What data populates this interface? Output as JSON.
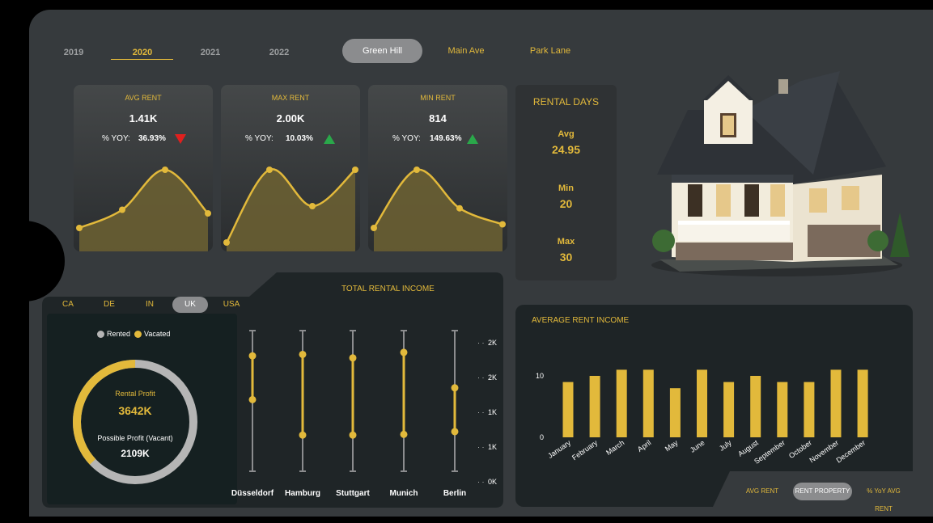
{
  "years": [
    "2019",
    "2020",
    "2021",
    "2022"
  ],
  "selected_year": "2020",
  "properties": [
    "Green Hill",
    "Main Ave",
    "Park Lane"
  ],
  "selected_property": "Green Hill",
  "kpis": [
    {
      "label": "AVG RENT",
      "value": "1.41K",
      "yoy_label": "% YOY:",
      "yoy": "36.93%",
      "trend": "down"
    },
    {
      "label": "MAX RENT",
      "value": "2.00K",
      "yoy_label": "% YOY:",
      "yoy": "10.03%",
      "trend": "up"
    },
    {
      "label": "MIN RENT",
      "value": "814",
      "yoy_label": "% YOY:",
      "yoy": "149.63%",
      "trend": "up"
    }
  ],
  "rental_days": {
    "title": "RENTAL DAYS",
    "avg_label": "Avg",
    "avg": "24.95",
    "min_label": "Min",
    "min": "20",
    "max_label": "Max",
    "max": "30"
  },
  "countries": [
    "CA",
    "DE",
    "IN",
    "UK",
    "USA"
  ],
  "selected_country": "UK",
  "legend": {
    "rented": "Rented",
    "vacated": "Vacated"
  },
  "donut": {
    "rental_profit_label": "Rental Profit",
    "rental_profit": "3642K",
    "possible_profit_label": "Possible Profit (Vacant)",
    "possible_profit": "2109K",
    "rented_fraction": 0.37
  },
  "colors": {
    "accent": "#e2b93b",
    "grey": "#b5b5b5",
    "down": "#e0201e",
    "up": "#2aa84a"
  },
  "total_rental_income_title": "TOTAL RENTAL INCOME",
  "average_rent_income_title": "AVERAGE RENT INCOME",
  "bottom_tabs": [
    "AVG RENT",
    "RENT PROPERTY",
    "% YoY AVG RENT"
  ],
  "selected_bottom_tab": "RENT PROPERTY",
  "chart_data": [
    {
      "type": "area",
      "title": "AVG RENT",
      "x": [
        1,
        2,
        3,
        4
      ],
      "values": [
        0.2,
        0.45,
        1.0,
        0.4
      ],
      "ylim": [
        0,
        1.1
      ]
    },
    {
      "type": "area",
      "title": "MAX RENT",
      "x": [
        1,
        2,
        3,
        4
      ],
      "values": [
        0.0,
        1.0,
        0.5,
        1.0
      ],
      "ylim": [
        0,
        1.1
      ]
    },
    {
      "type": "area",
      "title": "MIN RENT",
      "x": [
        1,
        2,
        3,
        4
      ],
      "values": [
        0.2,
        1.0,
        0.47,
        0.25
      ],
      "ylim": [
        0,
        1.1
      ]
    },
    {
      "type": "dumbbell",
      "title": "TOTAL RENTAL INCOME",
      "categories": [
        "Düsseldorf",
        "Hamburg",
        "Stuttgart",
        "Munich",
        "Berlin"
      ],
      "y_ticks": [
        "0K",
        "1K",
        "1K",
        "2K",
        "2K"
      ],
      "ylim": [
        0,
        2000
      ],
      "range_low": [
        0,
        0,
        0,
        0,
        0
      ],
      "range_high": [
        2000,
        2000,
        2000,
        2000,
        2000
      ],
      "rented": [
        1170,
        660,
        660,
        670,
        710
      ],
      "vacated": [
        1800,
        1820,
        1770,
        1850,
        1340
      ]
    },
    {
      "type": "bar",
      "title": "AVERAGE RENT INCOME",
      "categories": [
        "January",
        "February",
        "March",
        "April",
        "May",
        "June",
        "July",
        "August",
        "September",
        "October",
        "November",
        "December"
      ],
      "values": [
        9,
        10,
        11,
        11,
        8,
        11,
        9,
        10,
        9,
        9,
        11,
        11
      ],
      "y_ticks": [
        "0",
        "10"
      ],
      "ylim": [
        0,
        15
      ]
    }
  ]
}
